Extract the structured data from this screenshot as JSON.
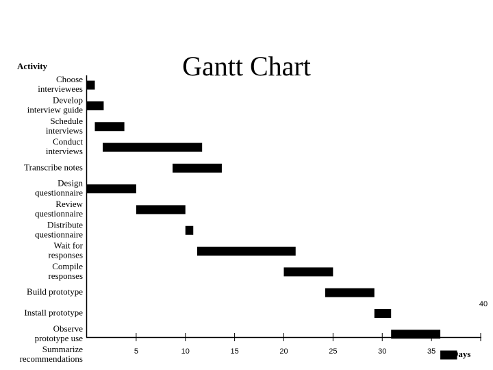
{
  "chart_data": {
    "type": "bar",
    "subtype": "gantt",
    "title": "Gantt Chart",
    "ylabel": "Activity",
    "xlabel": "Days",
    "xlim": [
      0,
      40
    ],
    "xticks": [
      5,
      10,
      15,
      20,
      25,
      30,
      35,
      40
    ],
    "grid": false,
    "legend": "none",
    "bar_color": "#000000",
    "tasks": [
      {
        "label": [
          "Choose",
          "interviewees"
        ],
        "start": 0,
        "end": 0.8
      },
      {
        "label": [
          "Develop",
          "interview guide"
        ],
        "start": 0,
        "end": 1.7
      },
      {
        "label": [
          "Schedule",
          "interviews"
        ],
        "start": 0.8,
        "end": 3.8
      },
      {
        "label": [
          "Conduct",
          "interviews"
        ],
        "start": 1.6,
        "end": 11.7
      },
      {
        "label": [
          "Transcribe notes"
        ],
        "start": 8.7,
        "end": 13.7
      },
      {
        "label": [
          "Design",
          "questionnaire"
        ],
        "start": 0,
        "end": 5
      },
      {
        "label": [
          "Review",
          "questionnaire"
        ],
        "start": 5,
        "end": 10
      },
      {
        "label": [
          "Distribute",
          "questionnaire"
        ],
        "start": 10,
        "end": 10.8
      },
      {
        "label": [
          "Wait for",
          "responses"
        ],
        "start": 11.2,
        "end": 21.2
      },
      {
        "label": [
          "Compile",
          "responses"
        ],
        "start": 20,
        "end": 25
      },
      {
        "label": [
          "Build prototype"
        ],
        "start": 24.2,
        "end": 29.2
      },
      {
        "label": [
          "Install prototype"
        ],
        "start": 29.2,
        "end": 30.9
      },
      {
        "label": [
          "Observe",
          "prototype use"
        ],
        "start": 30.9,
        "end": 35.9
      },
      {
        "label": [
          "Summarize",
          "recommendations"
        ],
        "start": 35.9,
        "end": 37.6
      }
    ]
  }
}
